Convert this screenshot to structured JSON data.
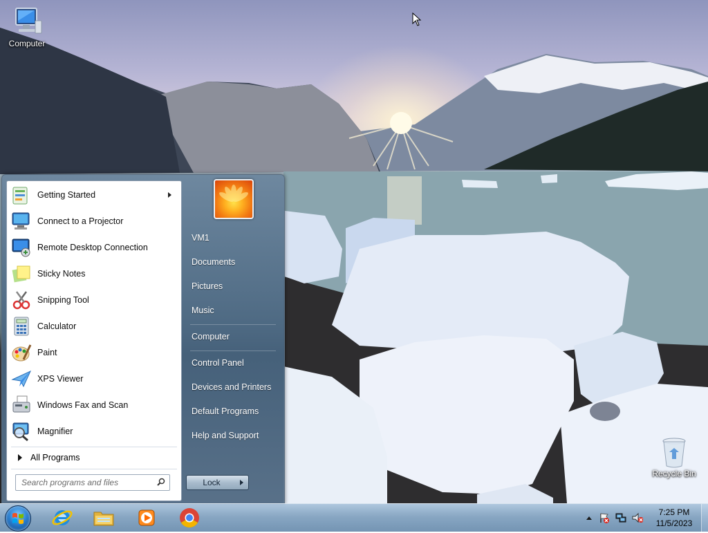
{
  "desktop": {
    "icons": [
      {
        "label": "Computer",
        "icon": "computer-icon"
      },
      {
        "label": "Recycle Bin",
        "icon": "recycle-bin-icon"
      }
    ]
  },
  "start_menu": {
    "programs": [
      {
        "label": "Getting Started",
        "icon": "getting-started-icon",
        "has_submenu": true
      },
      {
        "label": "Connect to a Projector",
        "icon": "projector-icon"
      },
      {
        "label": "Remote Desktop Connection",
        "icon": "remote-desktop-icon"
      },
      {
        "label": "Sticky Notes",
        "icon": "sticky-notes-icon"
      },
      {
        "label": "Snipping Tool",
        "icon": "snipping-tool-icon"
      },
      {
        "label": "Calculator",
        "icon": "calculator-icon"
      },
      {
        "label": "Paint",
        "icon": "paint-icon"
      },
      {
        "label": "XPS Viewer",
        "icon": "xps-viewer-icon"
      },
      {
        "label": "Windows Fax and Scan",
        "icon": "fax-scan-icon"
      },
      {
        "label": "Magnifier",
        "icon": "magnifier-icon"
      }
    ],
    "all_programs": "All Programs",
    "search_placeholder": "Search programs and files",
    "right_items": [
      {
        "label": "VM1"
      },
      {
        "label": "Documents"
      },
      {
        "label": "Pictures"
      },
      {
        "label": "Music"
      },
      {
        "label": "Computer"
      },
      {
        "label": "Control Panel"
      },
      {
        "label": "Devices and Printers"
      },
      {
        "label": "Default Programs"
      },
      {
        "label": "Help and Support"
      }
    ],
    "lock_label": "Lock"
  },
  "taskbar": {
    "pinned": [
      {
        "name": "internet-explorer",
        "icon": "internet-explorer-icon"
      },
      {
        "name": "windows-explorer",
        "icon": "folder-icon"
      },
      {
        "name": "media-player",
        "icon": "media-player-icon"
      },
      {
        "name": "chrome",
        "icon": "chrome-icon"
      }
    ],
    "tray": [
      "show-hidden-icons-arrow",
      "action-center-flag-icon",
      "network-icon",
      "volume-muted-icon"
    ],
    "clock": {
      "time": "7:25 PM",
      "date": "11/5/2023"
    }
  },
  "colors": {
    "taskbar": "#82a2c0",
    "start_menu_right": "#46627c",
    "accent_orange": "#f27a12"
  }
}
